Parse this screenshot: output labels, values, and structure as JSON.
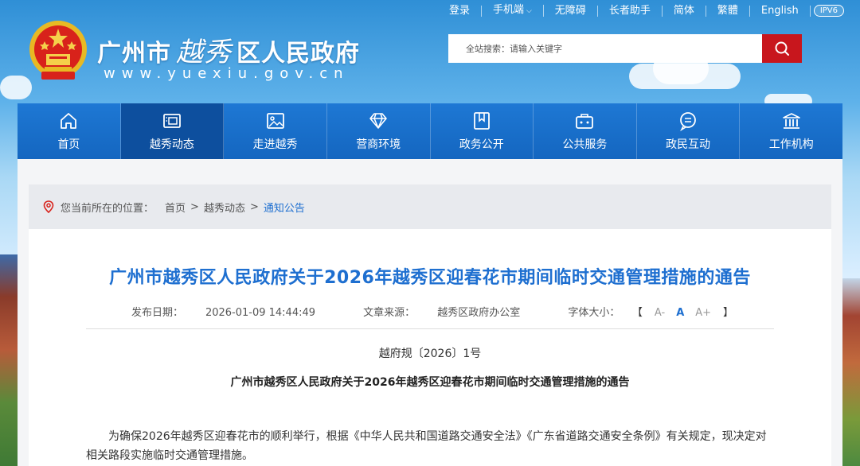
{
  "topbar": {
    "links": [
      "登录",
      "手机端",
      "无障碍",
      "长者助手",
      "简体",
      "繁體",
      "English"
    ],
    "ipv6": "IPV6"
  },
  "header": {
    "city": "广州市",
    "calligraphy": "越秀",
    "district_suffix": "区人民政府",
    "url": "www.yuexiu.gov.cn"
  },
  "search": {
    "placeholder": "全站搜索：请输入关键字"
  },
  "nav": {
    "items": [
      {
        "label": "首页",
        "icon": "home-icon"
      },
      {
        "label": "越秀动态",
        "icon": "news-icon"
      },
      {
        "label": "走进越秀",
        "icon": "picture-icon"
      },
      {
        "label": "营商环境",
        "icon": "diamond-icon"
      },
      {
        "label": "政务公开",
        "icon": "bookmark-icon"
      },
      {
        "label": "公共服务",
        "icon": "briefcase-icon"
      },
      {
        "label": "政民互动",
        "icon": "chat-icon"
      },
      {
        "label": "工作机构",
        "icon": "institution-icon"
      }
    ],
    "active_index": 1
  },
  "breadcrumb": {
    "prefix": "您当前所在的位置：",
    "items": [
      "首页",
      "越秀动态",
      "通知公告"
    ],
    "separator": ">"
  },
  "article": {
    "title": "广州市越秀区人民政府关于2026年越秀区迎春花市期间临时交通管理措施的通告",
    "publish_label": "发布日期：",
    "publish_date": "2026-01-09 14:44:49",
    "source_label": "文章来源：",
    "source": "越秀区政府办公室",
    "font_label": "字体大小：",
    "font_open": "【",
    "font_small": "A-",
    "font_mid": "A",
    "font_large": "A+",
    "font_close": "】",
    "doc_no": "越府规〔2026〕1号",
    "subtitle": "广州市越秀区人民政府关于2026年越秀区迎春花市期间临时交通管理措施的通告",
    "paragraph": "为确保2026年越秀区迎春花市的顺利举行，根据《中华人民共和国道路交通安全法》《广东省道路交通安全条例》有关规定，现决定对相关路段实施临时交通管理措施。"
  },
  "colors": {
    "nav_bg": "#1466c0",
    "nav_active": "#0d4f9e",
    "search_btn": "#c8161d",
    "title_blue": "#1e6fd0"
  }
}
